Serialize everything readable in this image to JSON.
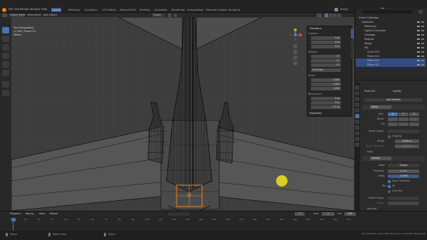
{
  "topbar": {
    "menus": [
      "File",
      "Edit",
      "Render",
      "Window",
      "Help"
    ],
    "workspaces": [
      "Layout",
      "Modeling",
      "Sculpting",
      "UV Editing",
      "Texture Paint",
      "Shading",
      "Animation",
      "Rendering",
      "Compositing",
      "Geometry Nodes",
      "Scripting"
    ],
    "active_workspace": "Layout",
    "scene": "Scene",
    "view_layer": "ViewLayer"
  },
  "viewport_header": {
    "mode": "Object Mode",
    "menus": [
      "View",
      "Select",
      "Add",
      "Object"
    ],
    "pivot": "Global",
    "options": "Options"
  },
  "viewport_overlay_text": {
    "view_name": "Top Orthographic",
    "object": "(1) Tail | Plane.011",
    "units": "Meters"
  },
  "npanel": {
    "title": "Transform",
    "location_label": "Location:",
    "location": [
      "0 m",
      "0 m",
      "0 m"
    ],
    "rotation_label": "Rotation:",
    "rotation": [
      "0°",
      "0°",
      "0°"
    ],
    "rotation_mode": "XYZ Euler",
    "scale_label": "Scale:",
    "scale": [
      "1.000",
      "1.000",
      "1.000"
    ],
    "dimensions_label": "Dimensions:",
    "dimensions": [
      "0 m",
      "0 m",
      "0.1 m"
    ],
    "properties_label": "Properties",
    "tabs": [
      "Item",
      "Tool",
      "View"
    ]
  },
  "outliner": {
    "rows": [
      {
        "label": "Scene Collection",
        "selected": false
      },
      {
        "label": "Collection",
        "selected": false
      },
      {
        "label": "Reference",
        "selected": false
      },
      {
        "label": "Lights & Cameras",
        "selected": false
      },
      {
        "label": "Fuselage",
        "selected": false
      },
      {
        "label": "Engines",
        "selected": false
      },
      {
        "label": "Wings",
        "selected": false
      },
      {
        "label": "Tail",
        "selected": false
      },
      {
        "label": "Circle.013",
        "selected": false
      },
      {
        "label": "Plane.010",
        "selected": false
      },
      {
        "label": "Plane.011",
        "selected": true
      },
      {
        "label": "Plane.012",
        "selected": true
      }
    ]
  },
  "properties": {
    "breadcrumb": "Plane.011",
    "modifier_breadcrumb": "Solidify",
    "add_modifier": "Add Modifier",
    "mirror": {
      "name": "Mirror",
      "axis_label": "Axis",
      "bisect_label": "Bisect",
      "flip_label": "Flip",
      "axes": [
        "X",
        "Y",
        "Z"
      ],
      "mirror_object_label": "Mirror Object",
      "clipping_label": "Clipping",
      "merge_label": "Merge",
      "merge_value": "0.001 m",
      "bisect_distance_label": "Bisect Distance",
      "bisect_distance_value": "0.001 m",
      "data_label": "Data"
    },
    "solidify": {
      "name": "Solidify",
      "mode_label": "Mode",
      "mode_value": "Simple",
      "thickness_label": "Thickness",
      "thickness_value": "0.1 m",
      "offset_label": "Offset",
      "offset_value": "-1.0000",
      "even_thickness": "Even Thickness",
      "rim_label": "Rim",
      "fill": "Fill",
      "only_rim": "Only Rim",
      "vertex_group_label": "Vertex Group",
      "factor_label": "Factor",
      "normals_label": "Normals",
      "flip": "Flip",
      "high_quality": "High Quality"
    }
  },
  "timeline": {
    "menus": [
      "Playback",
      "Keying",
      "View",
      "Marker"
    ],
    "current_frame": "1",
    "start_label": "Start",
    "start": "1",
    "end_label": "End",
    "end": "250",
    "ticks": [
      "0",
      "10",
      "20",
      "30",
      "40",
      "50",
      "60",
      "70",
      "80",
      "90",
      "100",
      "110",
      "120",
      "130",
      "140",
      "150",
      "160",
      "170",
      "180",
      "190",
      "200",
      "210",
      "220",
      "230",
      "240",
      "250"
    ]
  },
  "statusbar": {
    "items": [
      "Select",
      "Rotate View",
      "Object"
    ],
    "right": "Tail | Plane.011 | Verts:4,256 | Faces:4,141 | Tris:8,282 | Objects:1/60"
  },
  "colors": {
    "accent": "#4a72b0",
    "selection_orange": "#e8842a",
    "cursor_yellow": "#f2e21a",
    "viewport_bg": "#3d3d3d",
    "grid": "#4a4a4a",
    "wire": "#0a0a0a"
  }
}
